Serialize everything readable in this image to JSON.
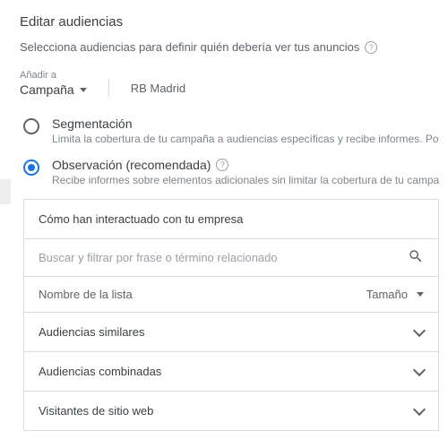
{
  "title": "Editar audiencias",
  "subtitle": "Selecciona audiencias para definir quién debería ver tus anuncios",
  "add_to": {
    "label": "Añadir a",
    "value": "Campaña",
    "campaign": "RB Madrid"
  },
  "radios": {
    "segmentation": {
      "title": "Segmentación",
      "desc": "Limita la cobertura de tu campaña a audiencias específicas y recibe informes. Pod"
    },
    "observation": {
      "title": "Observación (recomendada)",
      "desc": "Recibe informes sobre elementos adicionales sin limitar la cobertura de tu campañ"
    }
  },
  "panel": {
    "header": "Cómo han interactuado con tu empresa",
    "search_placeholder": "Buscar y filtrar por frase o término relacionado",
    "col_name": "Nombre de la lista",
    "col_size": "Tamaño",
    "rows": {
      "0": "Audiencias similares",
      "1": "Audiencias combinadas",
      "2": "Visitantes de sitio web"
    }
  }
}
